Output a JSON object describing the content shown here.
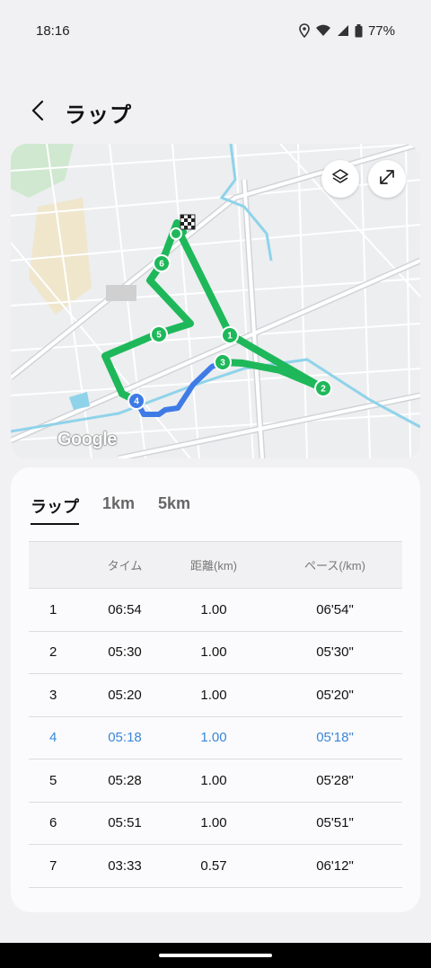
{
  "status_bar": {
    "time": "18:16",
    "battery": "77%"
  },
  "header": {
    "title": "ラップ",
    "back_icon": "chevron-left-icon"
  },
  "map": {
    "layers_icon": "layers-icon",
    "expand_icon": "expand-icon",
    "attribution": "Google",
    "markers": [
      "1",
      "2",
      "3",
      "4",
      "5",
      "6"
    ],
    "route_color": "#1eb85a",
    "highlight_color": "#3f7be6"
  },
  "tabs": [
    {
      "label": "ラップ",
      "active": true
    },
    {
      "label": "1km",
      "active": false
    },
    {
      "label": "5km",
      "active": false
    }
  ],
  "table": {
    "headers": {
      "lap": "",
      "time": "タイム",
      "distance": "距離(km)",
      "pace": "ペース(/km)"
    },
    "rows": [
      {
        "lap": "1",
        "time": "06:54",
        "distance": "1.00",
        "pace": "06'54\""
      },
      {
        "lap": "2",
        "time": "05:30",
        "distance": "1.00",
        "pace": "05'30\""
      },
      {
        "lap": "3",
        "time": "05:20",
        "distance": "1.00",
        "pace": "05'20\""
      },
      {
        "lap": "4",
        "time": "05:18",
        "distance": "1.00",
        "pace": "05'18\""
      },
      {
        "lap": "5",
        "time": "05:28",
        "distance": "1.00",
        "pace": "05'28\""
      },
      {
        "lap": "6",
        "time": "05:51",
        "distance": "1.00",
        "pace": "05'51\""
      },
      {
        "lap": "7",
        "time": "03:33",
        "distance": "0.57",
        "pace": "06'12\""
      }
    ],
    "highlight_color": "#3a86d8"
  }
}
